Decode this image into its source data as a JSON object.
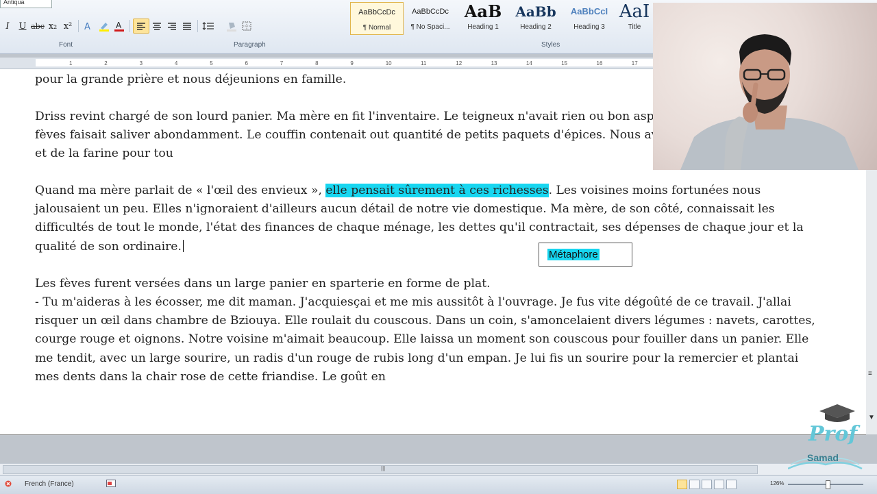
{
  "ribbon": {
    "font_name": "Antiqua",
    "groups": {
      "font": "Font",
      "paragraph": "Paragraph",
      "styles": "Styles"
    },
    "format_buttons": [
      "I",
      "U",
      "abc",
      "x₂",
      "x²"
    ],
    "styles": [
      {
        "preview": "AaBbCcDc",
        "name": "¶ Normal"
      },
      {
        "preview": "AaBbCcDc",
        "name": "¶ No Spaci..."
      },
      {
        "preview": "AaB",
        "name": "Heading 1"
      },
      {
        "preview": "AaBb",
        "name": "Heading 2"
      },
      {
        "preview": "AaBbCcI",
        "name": "Heading 3"
      },
      {
        "preview": "AaI",
        "name": "Title"
      }
    ]
  },
  "ruler": {
    "ticks": [
      "1",
      "2",
      "3",
      "4",
      "5",
      "6",
      "7",
      "8",
      "9",
      "10",
      "11",
      "12",
      "13",
      "14",
      "15",
      "16",
      "17"
    ]
  },
  "document": {
    "para1": "pour la grande prière et nous déjeunions en famille.",
    "para2": "Driss revint chargé de son lourd panier. Ma mère en fit l'inventaire. Le teigneux n'avait rien ou bon aspect et le vert des cosses de fèves faisait saliver abondamment. Le couffin contenait out quantité de petits paquets d'épices. Nous avions de l'huile, du charbon et de la farine pour tou",
    "para3_before": "Quand ma mère parlait de « l'œil des envieux », ",
    "para3_highlight": "elle pensait sûrement à ces richesses",
    "para3_after": ". Les voisines moins fortunées nous jalousaient un peu. Elles n'ignoraient d'ailleurs aucun détail de notre vie domestique. Ma mère, de son côté, connaissait les difficultés de tout le monde, l'état des finances de chaque ménage, les dettes qu'il contractait, ses dépenses de chaque jour et la qualité de son ordinaire.",
    "para4": "Les fèves furent versées dans un large panier en sparterie en forme de plat.",
    "para5": "- Tu m'aideras à les écosser, me dit maman. J'acquiesçai et me mis aussitôt à l'ouvrage. Je fus vite dégoûté de ce travail. J'allai risquer un œil dans chambre de Bziouya. Elle roulait du couscous. Dans un coin, s'amoncelaient divers légumes : navets, carottes, courge rouge et oignons. Notre voisine m'aimait beaucoup. Elle laissa un moment son couscous pour fouiller dans un panier. Elle me tendit, avec un large sourire, un radis d'un rouge de rubis long d'un empan. Je lui fis un sourire pour la remercier et plantai mes dents dans la chair rose de cette friandise. Le goût en"
  },
  "annotation": {
    "label": "Métaphore"
  },
  "status_bar": {
    "language": "French (France)",
    "zoom": "126%"
  },
  "logo": {
    "line1": "Prof",
    "line2": "Samad"
  },
  "colors": {
    "highlight": "#17d6f0",
    "ribbon_bg": "#dfe7f1"
  }
}
